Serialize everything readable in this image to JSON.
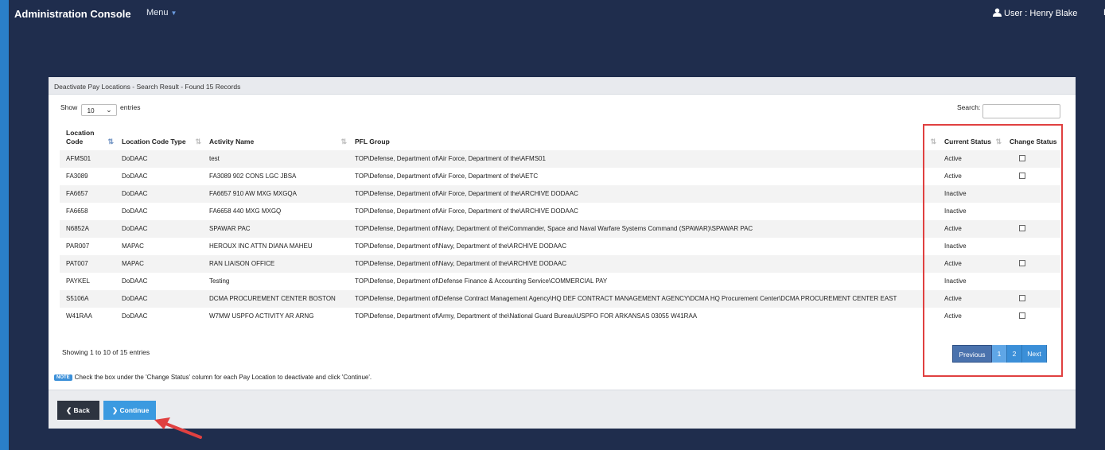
{
  "app": {
    "title": "Administration Console",
    "menu_label": "Menu",
    "user_label": "User : Henry Blake",
    "exit_label": "Ex"
  },
  "panel": {
    "heading": "Deactivate Pay Locations - Search Result - Found 15 Records"
  },
  "controls": {
    "show_label": "Show",
    "page_size": "10",
    "entries_label": "entries",
    "search_label": "Search:",
    "search_value": ""
  },
  "table": {
    "headers": [
      "Location Code",
      "Location Code Type",
      "Activity Name",
      "PFL Group",
      "Current Status",
      "Change Status"
    ],
    "rows": [
      {
        "code": "AFMS01",
        "type": "DoDAAC",
        "activity": "test",
        "pfl": "TOP\\Defense, Department of\\Air Force, Department of the\\AFMS01",
        "status": "Active",
        "checkbox": true
      },
      {
        "code": "FA3089",
        "type": "DoDAAC",
        "activity": "FA3089 902 CONS LGC JBSA",
        "pfl": "TOP\\Defense, Department of\\Air Force, Department of the\\AETC",
        "status": "Active",
        "checkbox": true
      },
      {
        "code": "FA6657",
        "type": "DoDAAC",
        "activity": "FA6657 910 AW MXG MXGQA",
        "pfl": "TOP\\Defense, Department of\\Air Force, Department of the\\ARCHIVE DODAAC",
        "status": "Inactive",
        "checkbox": false
      },
      {
        "code": "FA6658",
        "type": "DoDAAC",
        "activity": "FA6658 440 MXG MXGQ",
        "pfl": "TOP\\Defense, Department of\\Air Force, Department of the\\ARCHIVE DODAAC",
        "status": "Inactive",
        "checkbox": false
      },
      {
        "code": "N6852A",
        "type": "DoDAAC",
        "activity": "SPAWAR PAC",
        "pfl": "TOP\\Defense, Department of\\Navy, Department of the\\Commander, Space and Naval Warfare Systems Command (SPAWAR)\\SPAWAR PAC",
        "status": "Active",
        "checkbox": true
      },
      {
        "code": "PAR007",
        "type": "MAPAC",
        "activity": "HEROUX INC ATTN DIANA MAHEU",
        "pfl": "TOP\\Defense, Department of\\Navy, Department of the\\ARCHIVE DODAAC",
        "status": "Inactive",
        "checkbox": false
      },
      {
        "code": "PAT007",
        "type": "MAPAC",
        "activity": "RAN LIAISON OFFICE",
        "pfl": "TOP\\Defense, Department of\\Navy, Department of the\\ARCHIVE DODAAC",
        "status": "Active",
        "checkbox": true
      },
      {
        "code": "PAYKEL",
        "type": "DoDAAC",
        "activity": "Testing",
        "pfl": "TOP\\Defense, Department of\\Defense Finance & Accounting Service\\COMMERCIAL PAY",
        "status": "Inactive",
        "checkbox": false
      },
      {
        "code": "S5106A",
        "type": "DoDAAC",
        "activity": "DCMA PROCUREMENT CENTER BOSTON",
        "pfl": "TOP\\Defense, Department of\\Defense Contract Management Agency\\HQ DEF CONTRACT MANAGEMENT AGENCY\\DCMA HQ Procurement Center\\DCMA PROCUREMENT CENTER EAST",
        "status": "Active",
        "checkbox": true
      },
      {
        "code": "W41RAA",
        "type": "DoDAAC",
        "activity": "W7MW USPFO ACTIVITY AR ARNG",
        "pfl": "TOP\\Defense, Department of\\Army, Department of the\\National Guard Bureau\\USPFO FOR ARKANSAS 03055 W41RAA",
        "status": "Active",
        "checkbox": true
      }
    ]
  },
  "pagination": {
    "info": "Showing 1 to 10 of 15 entries",
    "previous": "Previous",
    "page1": "1",
    "page2": "2",
    "next": "Next"
  },
  "note": {
    "badge": "NOTE",
    "text": "Check the box under the 'Change Status' column for each Pay Location to deactivate and click 'Continue'."
  },
  "buttons": {
    "back": "Back",
    "continue": "Continue"
  },
  "colors": {
    "background": "#1f2d4d",
    "accent": "#3b8fd8",
    "highlight": "#e04040"
  }
}
